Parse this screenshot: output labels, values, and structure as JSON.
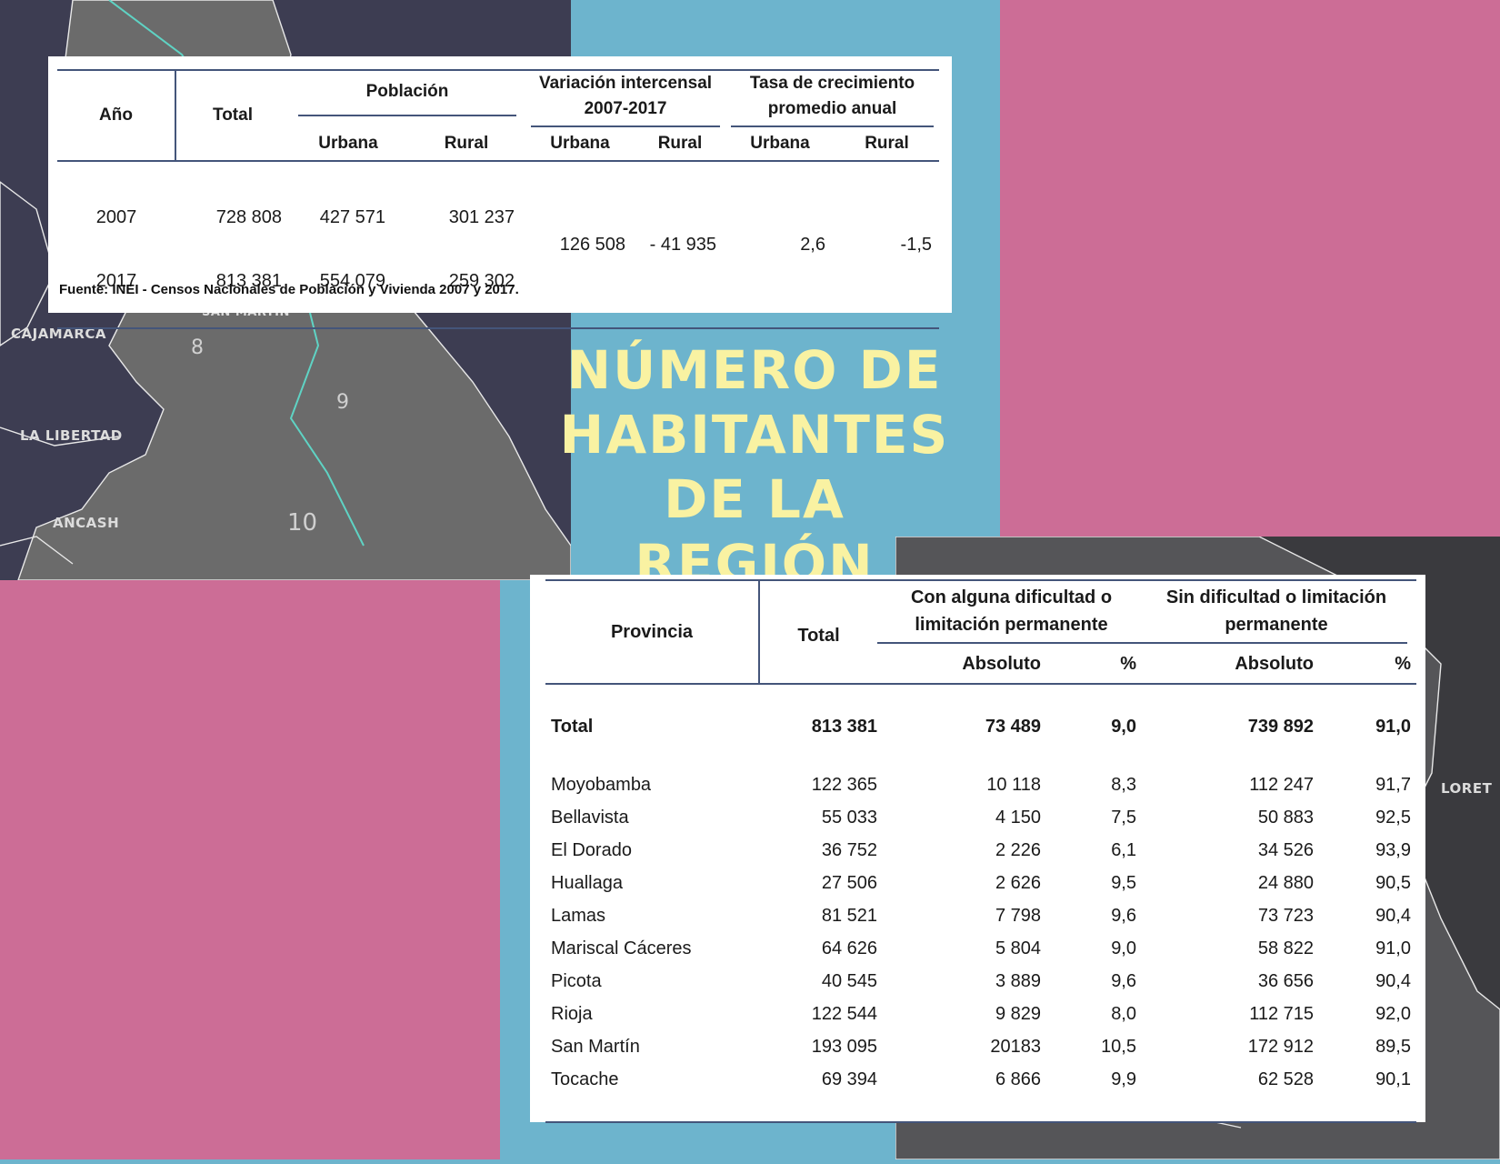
{
  "colors": {
    "pink": "#cc6d96",
    "teal": "#6db4cd",
    "map_dark": "#3d3d52",
    "headline": "#f9f2a2",
    "rule": "#44557a"
  },
  "headline": "NÚMERO DE HABITANTES DE LA REGIÓN",
  "map_labels": {
    "cajamarca": "CAJAMARCA",
    "san_martin": "SAN MARTIN",
    "la_libertad": "LA LIBERTAD",
    "ancash": "ANCASH",
    "loreto": "LORET",
    "n8": "8",
    "n9": "9",
    "n10": "10"
  },
  "table1": {
    "headers": {
      "anio": "Año",
      "total": "Total",
      "poblacion": "Población",
      "variacion": "Variación intercensal 2007-2017",
      "tasa": "Tasa de crecimiento promedio anual",
      "urbana": "Urbana",
      "rural": "Rural"
    },
    "rows": [
      {
        "anio": "2007",
        "total": "728 808",
        "urbana": "427 571",
        "rural": "301 237"
      },
      {
        "anio": "2017",
        "total": "813 381",
        "urbana": "554 079",
        "rural": "259 302"
      }
    ],
    "variacion": {
      "urbana": "126 508",
      "rural": "- 41 935"
    },
    "tasa": {
      "urbana": "2,6",
      "rural": "-1,5"
    },
    "source": "Fuente: INEI - Censos Nacionales de Población y Vivienda 2007 y 2017."
  },
  "table2": {
    "headers": {
      "provincia": "Provincia",
      "total": "Total",
      "con": "Con alguna dificultad o limitación permanente",
      "sin": "Sin dificultad o limitación permanente",
      "absoluto": "Absoluto",
      "pct": "%"
    },
    "total_row": {
      "provincia": "Total",
      "total": "813 381",
      "con_abs": "73 489",
      "con_pct": "9,0",
      "sin_abs": "739 892",
      "sin_pct": "91,0"
    },
    "rows": [
      {
        "provincia": "Moyobamba",
        "total": "122 365",
        "con_abs": "10 118",
        "con_pct": "8,3",
        "sin_abs": "112 247",
        "sin_pct": "91,7"
      },
      {
        "provincia": "Bellavista",
        "total": "55 033",
        "con_abs": "4 150",
        "con_pct": "7,5",
        "sin_abs": "50 883",
        "sin_pct": "92,5"
      },
      {
        "provincia": "El Dorado",
        "total": "36 752",
        "con_abs": "2 226",
        "con_pct": "6,1",
        "sin_abs": "34 526",
        "sin_pct": "93,9"
      },
      {
        "provincia": "Huallaga",
        "total": "27 506",
        "con_abs": "2 626",
        "con_pct": "9,5",
        "sin_abs": "24 880",
        "sin_pct": "90,5"
      },
      {
        "provincia": "Lamas",
        "total": "81 521",
        "con_abs": "7 798",
        "con_pct": "9,6",
        "sin_abs": "73 723",
        "sin_pct": "90,4"
      },
      {
        "provincia": "Mariscal Cáceres",
        "total": "64 626",
        "con_abs": "5 804",
        "con_pct": "9,0",
        "sin_abs": "58 822",
        "sin_pct": "91,0"
      },
      {
        "provincia": "Picota",
        "total": "40 545",
        "con_abs": "3 889",
        "con_pct": "9,6",
        "sin_abs": "36 656",
        "sin_pct": "90,4"
      },
      {
        "provincia": "Rioja",
        "total": "122 544",
        "con_abs": "9 829",
        "con_pct": "8,0",
        "sin_abs": "112 715",
        "sin_pct": "92,0"
      },
      {
        "provincia": "San Martín",
        "total": "193 095",
        "con_abs": "20183",
        "con_pct": "10,5",
        "sin_abs": "172 912",
        "sin_pct": "89,5"
      },
      {
        "provincia": "Tocache",
        "total": "69 394",
        "con_abs": "6 866",
        "con_pct": "9,9",
        "sin_abs": "62 528",
        "sin_pct": "90,1"
      }
    ]
  }
}
